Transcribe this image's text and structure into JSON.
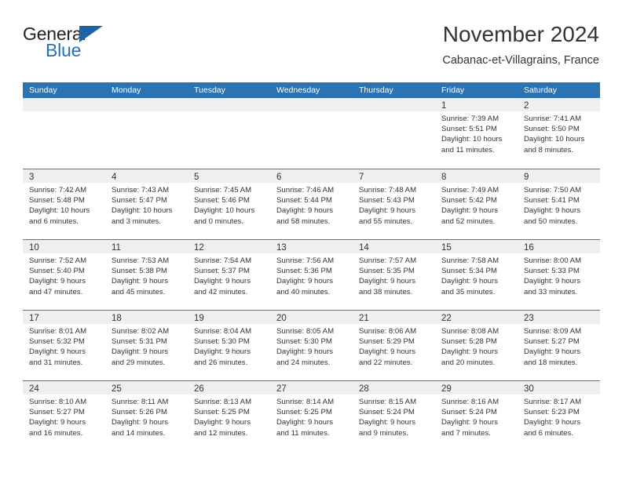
{
  "brand": {
    "name_top": "General",
    "name_bottom": "Blue",
    "triangle_color": "#1e62a8",
    "blue_color": "#2372b9",
    "dark_color": "#231f20"
  },
  "header": {
    "title": "November 2024",
    "subtitle": "Cabanac-et-Villagrains, France"
  },
  "theme": {
    "header_blue": "#2c73b4",
    "row_divider": "#3a7cbb",
    "daynum_band": "#efefef",
    "text": "#333333"
  },
  "weekdays": [
    "Sunday",
    "Monday",
    "Tuesday",
    "Wednesday",
    "Thursday",
    "Friday",
    "Saturday"
  ],
  "weeks": [
    [
      {
        "day": "",
        "lines": []
      },
      {
        "day": "",
        "lines": []
      },
      {
        "day": "",
        "lines": []
      },
      {
        "day": "",
        "lines": []
      },
      {
        "day": "",
        "lines": []
      },
      {
        "day": "1",
        "lines": [
          "Sunrise: 7:39 AM",
          "Sunset: 5:51 PM",
          "Daylight: 10 hours",
          "and 11 minutes."
        ]
      },
      {
        "day": "2",
        "lines": [
          "Sunrise: 7:41 AM",
          "Sunset: 5:50 PM",
          "Daylight: 10 hours",
          "and 8 minutes."
        ]
      }
    ],
    [
      {
        "day": "3",
        "lines": [
          "Sunrise: 7:42 AM",
          "Sunset: 5:48 PM",
          "Daylight: 10 hours",
          "and 6 minutes."
        ]
      },
      {
        "day": "4",
        "lines": [
          "Sunrise: 7:43 AM",
          "Sunset: 5:47 PM",
          "Daylight: 10 hours",
          "and 3 minutes."
        ]
      },
      {
        "day": "5",
        "lines": [
          "Sunrise: 7:45 AM",
          "Sunset: 5:46 PM",
          "Daylight: 10 hours",
          "and 0 minutes."
        ]
      },
      {
        "day": "6",
        "lines": [
          "Sunrise: 7:46 AM",
          "Sunset: 5:44 PM",
          "Daylight: 9 hours",
          "and 58 minutes."
        ]
      },
      {
        "day": "7",
        "lines": [
          "Sunrise: 7:48 AM",
          "Sunset: 5:43 PM",
          "Daylight: 9 hours",
          "and 55 minutes."
        ]
      },
      {
        "day": "8",
        "lines": [
          "Sunrise: 7:49 AM",
          "Sunset: 5:42 PM",
          "Daylight: 9 hours",
          "and 52 minutes."
        ]
      },
      {
        "day": "9",
        "lines": [
          "Sunrise: 7:50 AM",
          "Sunset: 5:41 PM",
          "Daylight: 9 hours",
          "and 50 minutes."
        ]
      }
    ],
    [
      {
        "day": "10",
        "lines": [
          "Sunrise: 7:52 AM",
          "Sunset: 5:40 PM",
          "Daylight: 9 hours",
          "and 47 minutes."
        ]
      },
      {
        "day": "11",
        "lines": [
          "Sunrise: 7:53 AM",
          "Sunset: 5:38 PM",
          "Daylight: 9 hours",
          "and 45 minutes."
        ]
      },
      {
        "day": "12",
        "lines": [
          "Sunrise: 7:54 AM",
          "Sunset: 5:37 PM",
          "Daylight: 9 hours",
          "and 42 minutes."
        ]
      },
      {
        "day": "13",
        "lines": [
          "Sunrise: 7:56 AM",
          "Sunset: 5:36 PM",
          "Daylight: 9 hours",
          "and 40 minutes."
        ]
      },
      {
        "day": "14",
        "lines": [
          "Sunrise: 7:57 AM",
          "Sunset: 5:35 PM",
          "Daylight: 9 hours",
          "and 38 minutes."
        ]
      },
      {
        "day": "15",
        "lines": [
          "Sunrise: 7:58 AM",
          "Sunset: 5:34 PM",
          "Daylight: 9 hours",
          "and 35 minutes."
        ]
      },
      {
        "day": "16",
        "lines": [
          "Sunrise: 8:00 AM",
          "Sunset: 5:33 PM",
          "Daylight: 9 hours",
          "and 33 minutes."
        ]
      }
    ],
    [
      {
        "day": "17",
        "lines": [
          "Sunrise: 8:01 AM",
          "Sunset: 5:32 PM",
          "Daylight: 9 hours",
          "and 31 minutes."
        ]
      },
      {
        "day": "18",
        "lines": [
          "Sunrise: 8:02 AM",
          "Sunset: 5:31 PM",
          "Daylight: 9 hours",
          "and 29 minutes."
        ]
      },
      {
        "day": "19",
        "lines": [
          "Sunrise: 8:04 AM",
          "Sunset: 5:30 PM",
          "Daylight: 9 hours",
          "and 26 minutes."
        ]
      },
      {
        "day": "20",
        "lines": [
          "Sunrise: 8:05 AM",
          "Sunset: 5:30 PM",
          "Daylight: 9 hours",
          "and 24 minutes."
        ]
      },
      {
        "day": "21",
        "lines": [
          "Sunrise: 8:06 AM",
          "Sunset: 5:29 PM",
          "Daylight: 9 hours",
          "and 22 minutes."
        ]
      },
      {
        "day": "22",
        "lines": [
          "Sunrise: 8:08 AM",
          "Sunset: 5:28 PM",
          "Daylight: 9 hours",
          "and 20 minutes."
        ]
      },
      {
        "day": "23",
        "lines": [
          "Sunrise: 8:09 AM",
          "Sunset: 5:27 PM",
          "Daylight: 9 hours",
          "and 18 minutes."
        ]
      }
    ],
    [
      {
        "day": "24",
        "lines": [
          "Sunrise: 8:10 AM",
          "Sunset: 5:27 PM",
          "Daylight: 9 hours",
          "and 16 minutes."
        ]
      },
      {
        "day": "25",
        "lines": [
          "Sunrise: 8:11 AM",
          "Sunset: 5:26 PM",
          "Daylight: 9 hours",
          "and 14 minutes."
        ]
      },
      {
        "day": "26",
        "lines": [
          "Sunrise: 8:13 AM",
          "Sunset: 5:25 PM",
          "Daylight: 9 hours",
          "and 12 minutes."
        ]
      },
      {
        "day": "27",
        "lines": [
          "Sunrise: 8:14 AM",
          "Sunset: 5:25 PM",
          "Daylight: 9 hours",
          "and 11 minutes."
        ]
      },
      {
        "day": "28",
        "lines": [
          "Sunrise: 8:15 AM",
          "Sunset: 5:24 PM",
          "Daylight: 9 hours",
          "and 9 minutes."
        ]
      },
      {
        "day": "29",
        "lines": [
          "Sunrise: 8:16 AM",
          "Sunset: 5:24 PM",
          "Daylight: 9 hours",
          "and 7 minutes."
        ]
      },
      {
        "day": "30",
        "lines": [
          "Sunrise: 8:17 AM",
          "Sunset: 5:23 PM",
          "Daylight: 9 hours",
          "and 6 minutes."
        ]
      }
    ]
  ]
}
